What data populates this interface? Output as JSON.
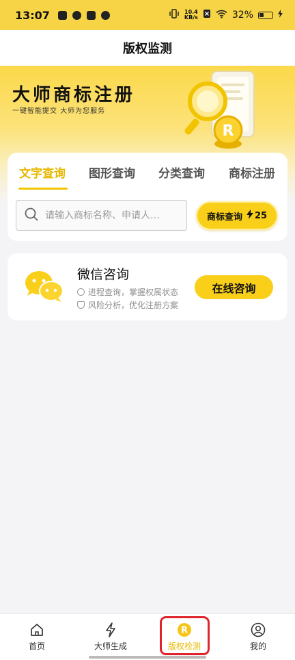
{
  "status_bar": {
    "time": "13:07",
    "net_speed_value": "10.4",
    "net_speed_unit": "KB/s",
    "battery": "32%"
  },
  "header": {
    "title": "版权监测"
  },
  "hero": {
    "title": "大师商标注册",
    "subtitle": "一键智能提交  大师为您服务"
  },
  "search": {
    "tabs": [
      {
        "label": "文字查询",
        "active": true
      },
      {
        "label": "图形查询",
        "active": false
      },
      {
        "label": "分类查询",
        "active": false
      },
      {
        "label": "商标注册",
        "active": false
      }
    ],
    "placeholder": "请输入商标名称、申请人…",
    "button_label": "商标查询",
    "button_count": "25"
  },
  "consult": {
    "title": "微信咨询",
    "line1": "进程查询，掌握权属状态",
    "line2": "风险分析，优化注册方案",
    "button_label": "在线咨询"
  },
  "bottom_nav": {
    "items": [
      {
        "label": "首页",
        "icon": "home-icon"
      },
      {
        "label": "大师生成",
        "icon": "lightning-icon"
      },
      {
        "label": "版权检测",
        "icon": "copyright-r-icon",
        "active": true
      },
      {
        "label": "我的",
        "icon": "user-icon"
      }
    ]
  },
  "colors": {
    "brand_yellow": "#f9cf1a",
    "active_text": "#e6b800",
    "highlight_red": "#e0242c"
  }
}
